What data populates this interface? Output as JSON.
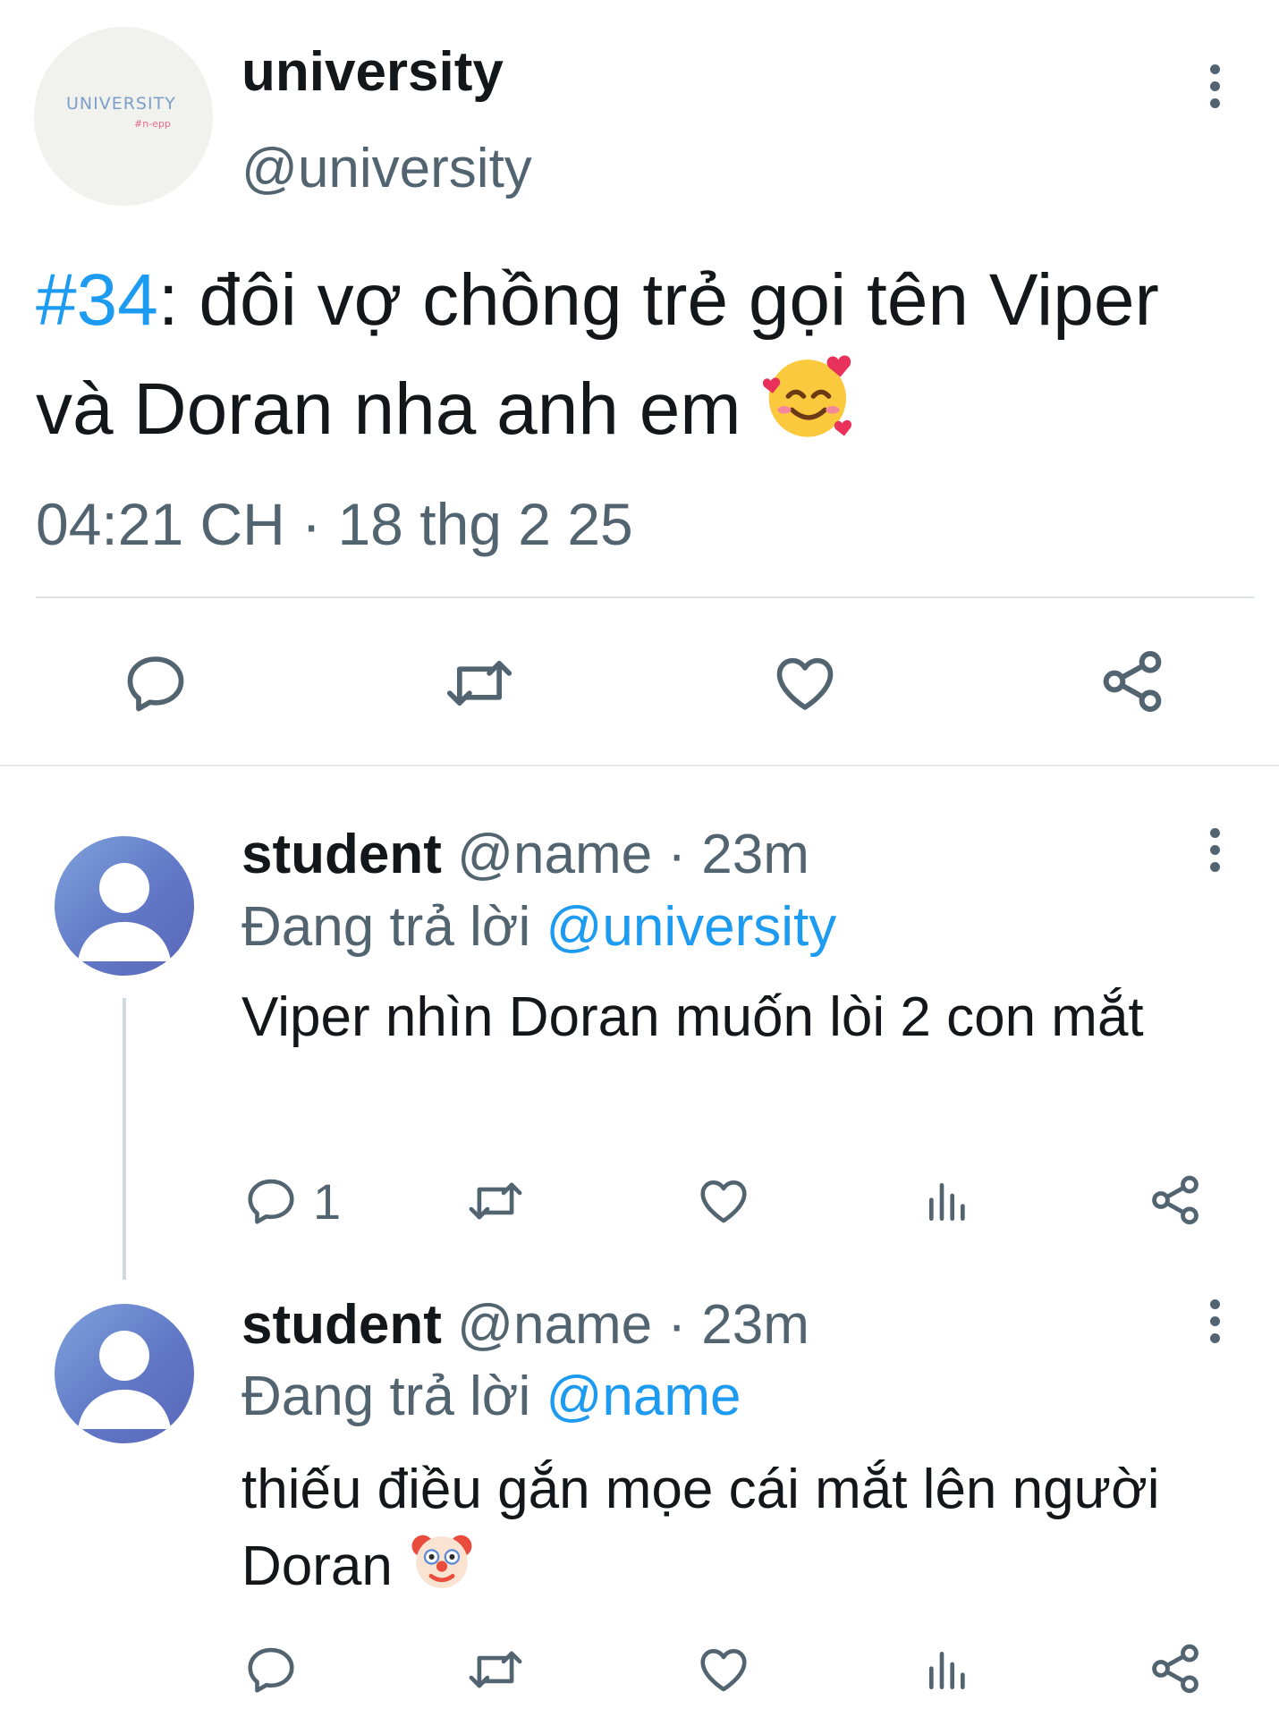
{
  "tweet": {
    "avatar_text": "UNIVERSITY",
    "avatar_subtext": "#n-epp",
    "display_name": "university",
    "handle": "@university",
    "hashtag": "#34",
    "text_line1_rest": ": đôi vợ chồng trẻ gọi tên Viper",
    "text_line2": "và Doran nha anh em",
    "emoji": "smiling-face-with-hearts",
    "timestamp": "04:21 CH · 18 thg 2 25"
  },
  "replies": [
    {
      "display_name": "student",
      "handle_time": "@name · 23m",
      "replying_prefix": "Đang trả lời",
      "replying_to": "@university",
      "text": "Viper nhìn Doran muốn lòi 2 con mắt",
      "reply_count": "1"
    },
    {
      "display_name": "student",
      "handle_time": "@name · 23m",
      "replying_prefix": "Đang trả lời",
      "replying_to": "@name",
      "text": "thiếu điều gắn mọe cái mắt lên người Doran",
      "emoji": "clown-face"
    }
  ],
  "colors": {
    "accent": "#1d9bf0",
    "secondary_text": "#536471",
    "primary_text": "#14171a"
  }
}
